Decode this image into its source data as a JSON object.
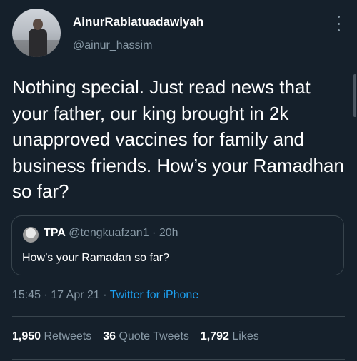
{
  "author": {
    "display_name": "AinurRabiatuadawiyah",
    "handle": "@ainur_hassim"
  },
  "tweet": {
    "text": "Nothing special. Just read news that your father, our king brought in 2k unapproved vaccines for family and business friends. How’s your Ramadhan so far?",
    "time": "15:45",
    "date": "17 Apr 21",
    "source": "Twitter for iPhone",
    "separator": "·"
  },
  "quoted_tweet": {
    "name": "TPA",
    "handle": "@tengkuafzan1",
    "age": "20h",
    "separator": "·",
    "text": "How’s your Ramadan so far?"
  },
  "stats": {
    "retweets_count": "1,950",
    "retweets_label": "Retweets",
    "quote_tweets_count": "36",
    "quote_tweets_label": "Quote Tweets",
    "likes_count": "1,792",
    "likes_label": "Likes"
  },
  "icons": {
    "more": "more-vertical-icon"
  },
  "colors": {
    "background": "#15202b",
    "secondary_text": "#8899a6",
    "link": "#1da1f2",
    "border": "#38444d"
  }
}
